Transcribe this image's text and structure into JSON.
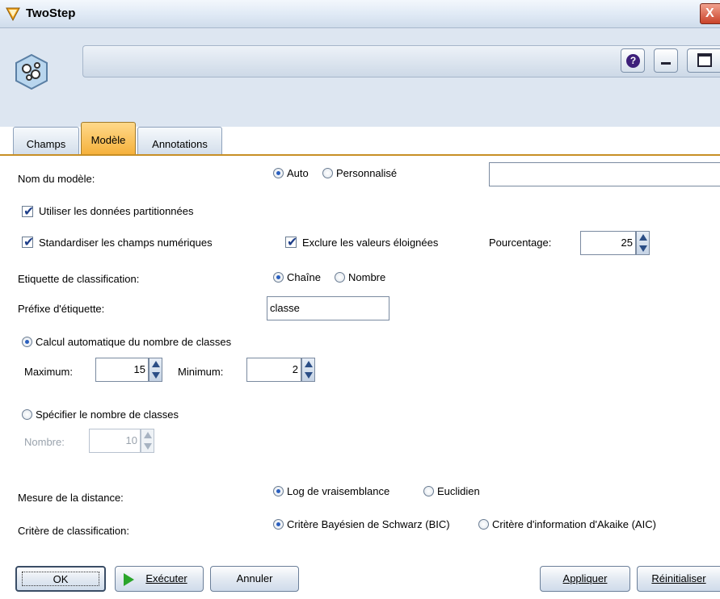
{
  "window": {
    "title": "TwoStep",
    "close_glyph": "X"
  },
  "header": {
    "help_glyph": "?"
  },
  "tabs": [
    {
      "label": "Champs",
      "active": false
    },
    {
      "label": "Modèle",
      "active": true
    },
    {
      "label": "Annotations",
      "active": false
    }
  ],
  "form": {
    "model_name": {
      "label": "Nom du modèle:",
      "options": [
        "Auto",
        "Personnalisé"
      ],
      "selected": "Auto",
      "value": ""
    },
    "use_partitioned": {
      "label": "Utiliser les données partitionnées",
      "checked": true
    },
    "standardize": {
      "label": "Standardiser les champs numériques",
      "checked": true
    },
    "exclude_outliers": {
      "label": "Exclure les valeurs éloignées",
      "checked": true
    },
    "percentage": {
      "label": "Pourcentage:",
      "value": "25"
    },
    "cluster_label": {
      "label": "Etiquette de classification:",
      "options": [
        "Chaîne",
        "Nombre"
      ],
      "selected": "Chaîne"
    },
    "label_prefix": {
      "label": "Préfixe d'étiquette:",
      "value": "classe"
    },
    "auto_clusters": {
      "label": "Calcul automatique du nombre de classes",
      "selected": true
    },
    "maximum": {
      "label": "Maximum:",
      "value": "15"
    },
    "minimum": {
      "label": "Minimum:",
      "value": "2"
    },
    "specify_clusters": {
      "label": "Spécifier le nombre de classes",
      "selected": false
    },
    "number": {
      "label": "Nombre:",
      "value": "10"
    },
    "distance": {
      "label": "Mesure de la distance:",
      "options": [
        "Log de vraisemblance",
        "Euclidien"
      ],
      "selected": "Log de vraisemblance"
    },
    "criterion": {
      "label": "Critère de classification:",
      "options": [
        "Critère Bayésien de Schwarz (BIC)",
        "Critère d'information d'Akaike (AIC)"
      ],
      "selected": "Critère Bayésien de Schwarz (BIC)"
    }
  },
  "buttons": {
    "ok": "OK",
    "run": "Exécuter",
    "cancel": "Annuler",
    "apply": "Appliquer",
    "reset": "Réinitialiser"
  },
  "colors": {
    "active_tab": "#f5b03a",
    "header_bg": "#dde6f1",
    "radio_dot": "#2a5fbf",
    "run_icon": "#2aa52a"
  }
}
